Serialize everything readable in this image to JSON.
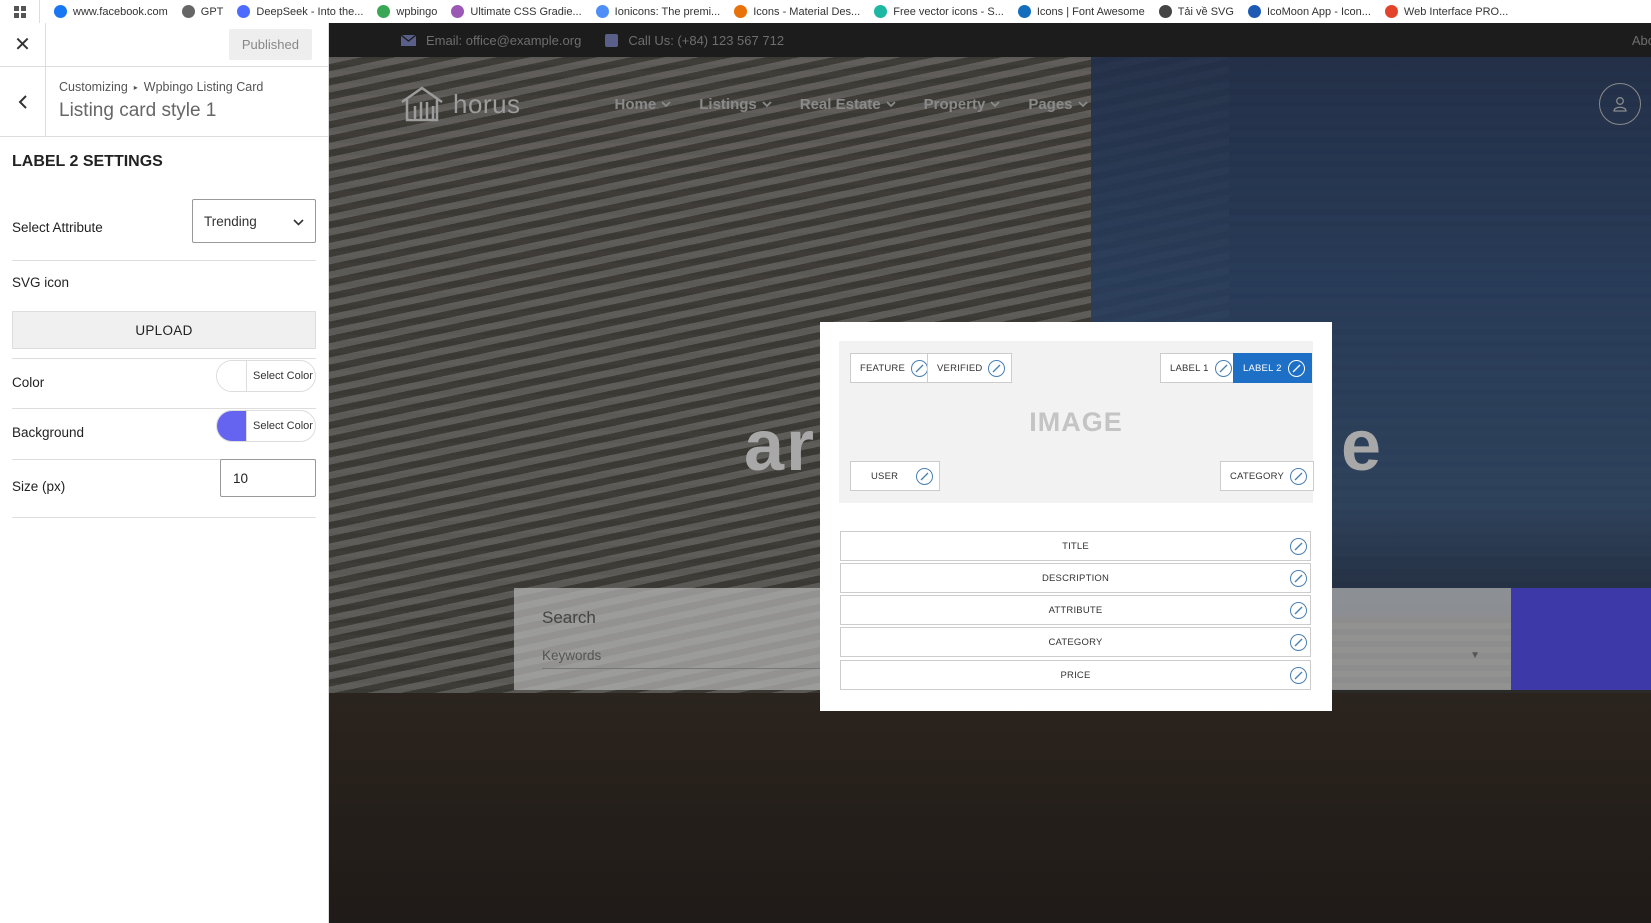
{
  "bookmarks": [
    {
      "label": "www.facebook.com",
      "color": "#1877f2"
    },
    {
      "label": "GPT",
      "color": "#666666"
    },
    {
      "label": "DeepSeek - Into the...",
      "color": "#4d6bfe"
    },
    {
      "label": "wpbingo",
      "color": "#3aa757"
    },
    {
      "label": "Ultimate CSS Gradie...",
      "color": "#9b59b6"
    },
    {
      "label": "Ionicons: The premi...",
      "color": "#4f8ef7"
    },
    {
      "label": "Icons - Material Des...",
      "color": "#e8710a"
    },
    {
      "label": "Free vector icons - S...",
      "color": "#1db8a4"
    },
    {
      "label": "Icons | Font Awesome",
      "color": "#146ebe"
    },
    {
      "label": "Tải về SVG",
      "color": "#444444"
    },
    {
      "label": "IcoMoon App - Icon...",
      "color": "#1e5ab4"
    },
    {
      "label": "Web Interface PRO...",
      "color": "#e2432a"
    }
  ],
  "sidebar": {
    "published_label": "Published",
    "breadcrumb": [
      "Customizing",
      "Wpbingo Listing Card"
    ],
    "title": "Listing card style 1",
    "section_title": "LABEL 2 SETTINGS",
    "select_attribute_label": "Select Attribute",
    "select_attribute_value": "Trending",
    "svg_icon_label": "SVG icon",
    "upload_label": "UPLOAD",
    "color_label": "Color",
    "color_value": "#ffffff",
    "color_button": "Select Color",
    "background_label": "Background",
    "background_value": "#6464f0",
    "background_button": "Select Color",
    "size_label": "Size (px)",
    "size_value": "10"
  },
  "site": {
    "email": "Email: office@example.org",
    "phone": "Call Us: (+84) 123 567 712",
    "about": "Abo",
    "logo": "horus",
    "menu": [
      "Home",
      "Listings",
      "Real Estate",
      "Property",
      "Pages"
    ],
    "hero_left": "ar",
    "hero_right": "e",
    "search_title": "Search",
    "search_placeholder": "Keywords"
  },
  "card_builder": {
    "chips_top_left": [
      "FEATURE",
      "VERIFIED"
    ],
    "chips_top_right": [
      "LABEL 1",
      "LABEL 2"
    ],
    "active_chip": "LABEL 2",
    "image_label": "IMAGE",
    "chip_bottom_left": "USER",
    "chip_bottom_right": "CATEGORY",
    "fields": [
      "TITLE",
      "DESCRIPTION",
      "ATTRIBUTE",
      "CATEGORY",
      "PRICE"
    ],
    "accent_color": "#1e6fc6"
  }
}
